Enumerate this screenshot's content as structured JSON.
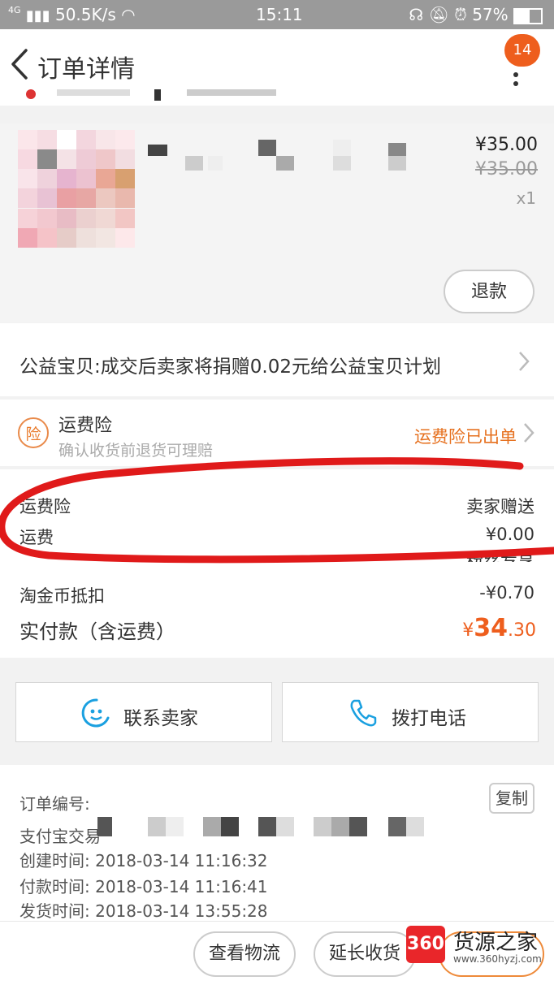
{
  "status_bar": {
    "network": "4G",
    "speed": "50.5K/s",
    "time": "15:11",
    "battery": "57%"
  },
  "nav": {
    "title": "订单详情",
    "badge": "14"
  },
  "product": {
    "price": "¥35.00",
    "original_price": "¥35.00",
    "qty": "x1",
    "refund_label": "退款"
  },
  "charity": {
    "text": "公益宝贝:成交后卖家将捐赠0.02元给公益宝贝计划"
  },
  "insurance": {
    "icon_char": "险",
    "title": "运费险",
    "subtitle": "确认收货前退货可理赔",
    "status": "运费险已出单"
  },
  "fees": {
    "insurance_label": "运费险",
    "insurance_value": "卖家赠送",
    "shipping_label": "运费",
    "shipping_value": "¥0.00",
    "extra": "粉丝专享",
    "coin_label": "淘金币抵扣",
    "coin_value": "-¥0.70",
    "total_label": "实付款（含运费）",
    "total_currency": "¥",
    "total_int": "34",
    "total_dec": ".30"
  },
  "actions": {
    "contact_seller": "联系卖家",
    "call": "拨打电话"
  },
  "order_info": {
    "order_no_label": "订单编号:",
    "alipay_label": "支付宝交易",
    "copy_label": "复制",
    "created": "创建时间: 2018-03-14 11:16:32",
    "paid": "付款时间: 2018-03-14 11:16:41",
    "shipped": "发货时间: 2018-03-14 13:55:28"
  },
  "bottom": {
    "logistics": "查看物流",
    "extend": "延长收货"
  },
  "watermark": {
    "logo": "360",
    "name": "货源之家",
    "url": "www.360hyzj.com"
  },
  "colors": {
    "accent": "#ee5e1d",
    "annotation": "#e01a1a"
  }
}
